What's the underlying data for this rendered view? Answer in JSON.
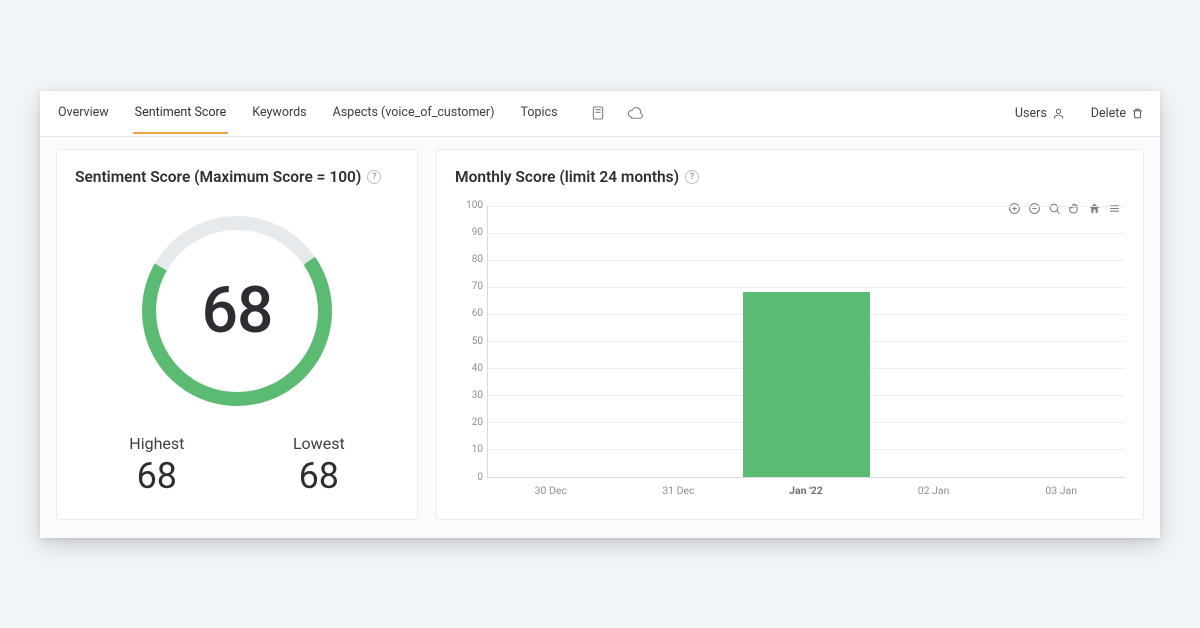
{
  "tabs": {
    "overview": "Overview",
    "sentiment_score": "Sentiment Score",
    "keywords": "Keywords",
    "aspects": "Aspects (voice_of_customer)",
    "topics": "Topics"
  },
  "right_actions": {
    "users": "Users",
    "delete": "Delete"
  },
  "left_card": {
    "title": "Sentiment Score (Maximum Score = 100)",
    "score": "68",
    "score_pct": 68,
    "highest_label": "Highest",
    "highest_value": "68",
    "lowest_label": "Lowest",
    "lowest_value": "68"
  },
  "right_card": {
    "title": "Monthly Score (limit 24 months)"
  },
  "colors": {
    "accent_green": "#5bbb73",
    "track_grey": "#e7eaec",
    "tab_underline": "#f2a445",
    "toolbar_active": "#2c9fe6"
  },
  "chart_data": {
    "type": "bar",
    "categories": [
      "30 Dec",
      "31 Dec",
      "Jan '22",
      "02 Jan",
      "03 Jan"
    ],
    "values": [
      null,
      null,
      68,
      null,
      null
    ],
    "title": "Monthly Score (limit 24 months)",
    "xlabel": "",
    "ylabel": "",
    "ylim": [
      0,
      100
    ],
    "y_ticks": [
      0,
      10,
      20,
      30,
      40,
      50,
      60,
      70,
      80,
      90,
      100
    ]
  }
}
